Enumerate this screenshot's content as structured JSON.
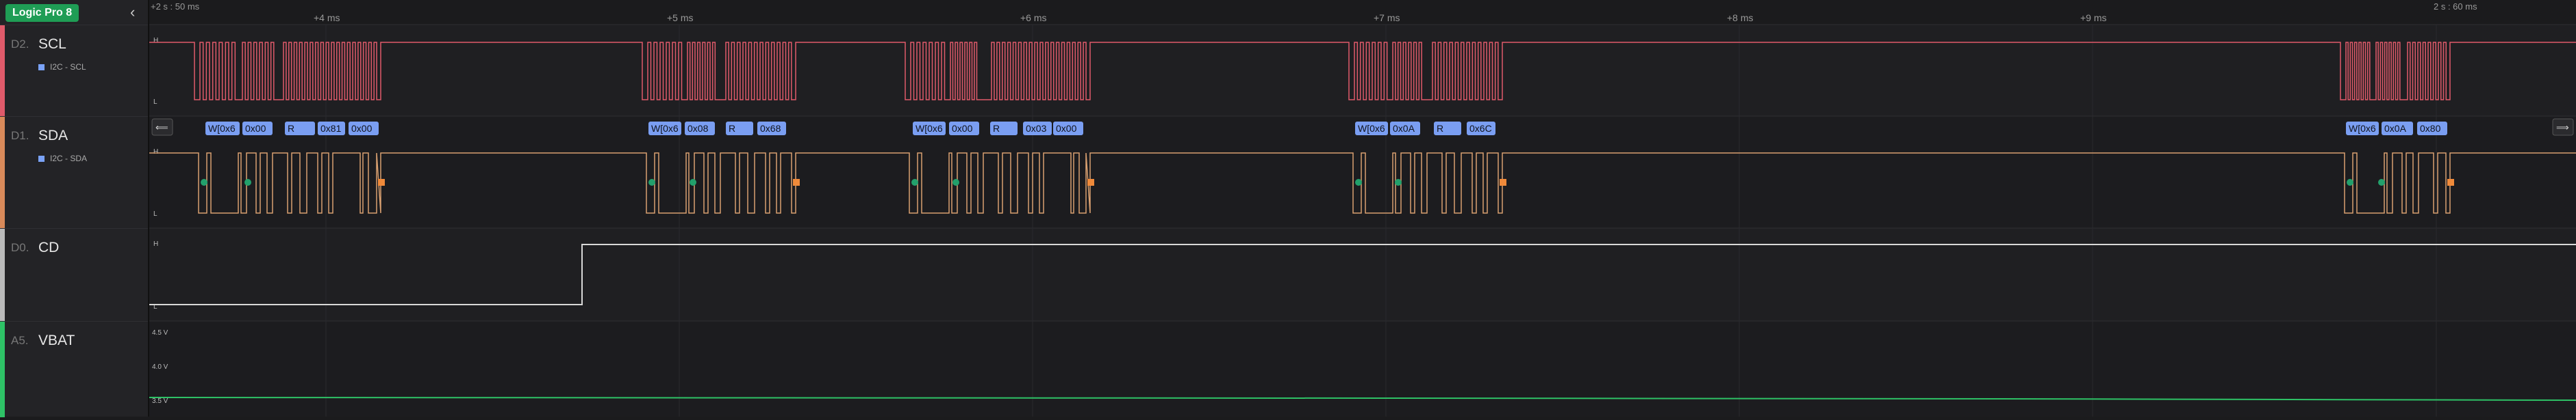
{
  "app": {
    "title": "Logic Pro 8"
  },
  "channels": [
    {
      "index": "D2.",
      "name": "SCL",
      "analyzer": "I2C - SCL",
      "color": "#e05a6a"
    },
    {
      "index": "D1.",
      "name": "SDA",
      "analyzer": "I2C - SDA",
      "color": "#d98a5a"
    },
    {
      "index": "D0.",
      "name": "CD",
      "analyzer": "",
      "color": "#bbbbbb"
    },
    {
      "index": "A5.",
      "name": "VBAT",
      "analyzer": "",
      "color": "#2ec266"
    }
  ],
  "timeline": {
    "start_label": "+2 s : 50 ms",
    "end_label": "2 s : 60 ms",
    "ticks": [
      "+4 ms",
      "+5 ms",
      "+6 ms",
      "+7 ms",
      "+8 ms",
      "+9 ms"
    ]
  },
  "levels": {
    "high": "H",
    "low": "L"
  },
  "vbat_axis": [
    "4.5 V",
    "4.0 V",
    "3.5 V"
  ],
  "decoded_frames": [
    [
      "W[0x6",
      "0x00",
      "R",
      "0x81",
      "0x00"
    ],
    [
      "W[0x6",
      "0x08",
      "R",
      "0x68"
    ],
    [
      "W[0x6",
      "0x00",
      "R",
      "0x03",
      "0x00"
    ],
    [
      "W[0x6",
      "0x0A",
      "R",
      "0x6C"
    ],
    [
      "W[0x6",
      "0x0A",
      "0x80"
    ]
  ],
  "nav_buttons": {
    "prev": "⟸",
    "next": "⟹"
  }
}
